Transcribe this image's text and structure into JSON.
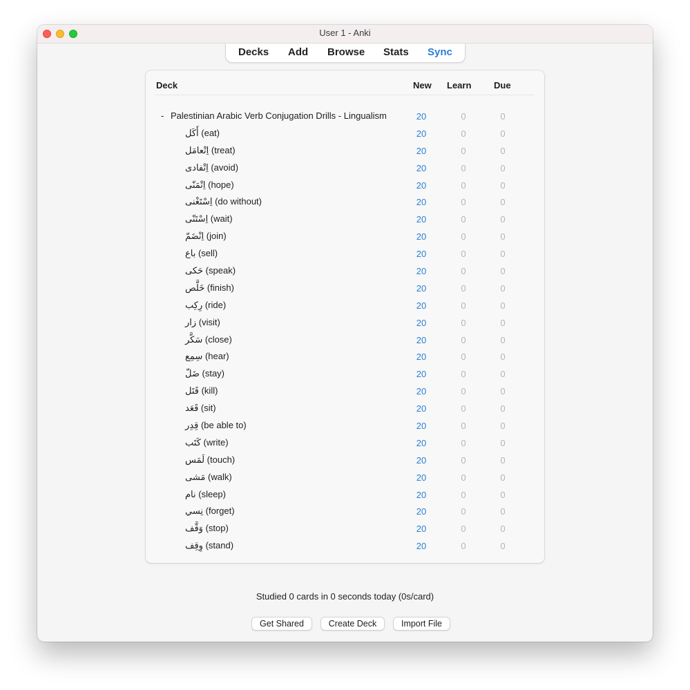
{
  "window": {
    "title": "User 1 - Anki"
  },
  "toolbar": {
    "items": [
      {
        "label": "Decks"
      },
      {
        "label": "Add"
      },
      {
        "label": "Browse"
      },
      {
        "label": "Stats"
      },
      {
        "label": "Sync",
        "active": true
      }
    ],
    "active_color": "#2a7fd4"
  },
  "table": {
    "headers": {
      "deck": "Deck",
      "new": "New",
      "learn": "Learn",
      "due": "Due"
    },
    "parent": {
      "collapse": "-",
      "name": "Palestinian Arabic Verb Conjugation Drills - Lingualism",
      "new": "20",
      "learn": "0",
      "due": "0"
    },
    "decks": [
      {
        "name": "أَكَل (eat)",
        "new": "20",
        "learn": "0",
        "due": "0"
      },
      {
        "name": "اِتْعامَل (treat)",
        "new": "20",
        "learn": "0",
        "due": "0"
      },
      {
        "name": "اِتْفادى (avoid)",
        "new": "20",
        "learn": "0",
        "due": "0"
      },
      {
        "name": "اِتْمَنّى (hope)",
        "new": "20",
        "learn": "0",
        "due": "0"
      },
      {
        "name": "اِسْتَغْنى (do without)",
        "new": "20",
        "learn": "0",
        "due": "0"
      },
      {
        "name": "اِسْتَنّى (wait)",
        "new": "20",
        "learn": "0",
        "due": "0"
      },
      {
        "name": "اِنْضَمّ (join)",
        "new": "20",
        "learn": "0",
        "due": "0"
      },
      {
        "name": "باع (sell)",
        "new": "20",
        "learn": "0",
        "due": "0"
      },
      {
        "name": "حَكى (speak)",
        "new": "20",
        "learn": "0",
        "due": "0"
      },
      {
        "name": "خَلَّص (finish)",
        "new": "20",
        "learn": "0",
        "due": "0"
      },
      {
        "name": "رِكِب (ride)",
        "new": "20",
        "learn": "0",
        "due": "0"
      },
      {
        "name": "زار (visit)",
        "new": "20",
        "learn": "0",
        "due": "0"
      },
      {
        "name": "سَكَّر (close)",
        "new": "20",
        "learn": "0",
        "due": "0"
      },
      {
        "name": "سِمِع (hear)",
        "new": "20",
        "learn": "0",
        "due": "0"
      },
      {
        "name": "ضَلّ (stay)",
        "new": "20",
        "learn": "0",
        "due": "0"
      },
      {
        "name": "قَتَل (kill)",
        "new": "20",
        "learn": "0",
        "due": "0"
      },
      {
        "name": "قَعَد (sit)",
        "new": "20",
        "learn": "0",
        "due": "0"
      },
      {
        "name": "قِدِر (be able to)",
        "new": "20",
        "learn": "0",
        "due": "0"
      },
      {
        "name": "كَتَب (write)",
        "new": "20",
        "learn": "0",
        "due": "0"
      },
      {
        "name": "لَمَس (touch)",
        "new": "20",
        "learn": "0",
        "due": "0"
      },
      {
        "name": "مَشى (walk)",
        "new": "20",
        "learn": "0",
        "due": "0"
      },
      {
        "name": "نام (sleep)",
        "new": "20",
        "learn": "0",
        "due": "0"
      },
      {
        "name": "نِسي (forget)",
        "new": "20",
        "learn": "0",
        "due": "0"
      },
      {
        "name": "وَقَّف (stop)",
        "new": "20",
        "learn": "0",
        "due": "0"
      },
      {
        "name": "وِقِف (stand)",
        "new": "20",
        "learn": "0",
        "due": "0"
      }
    ]
  },
  "footer": {
    "studied": "Studied 0 cards in 0 seconds today (0s/card)",
    "buttons": {
      "get_shared": "Get Shared",
      "create_deck": "Create Deck",
      "import_file": "Import File"
    }
  }
}
